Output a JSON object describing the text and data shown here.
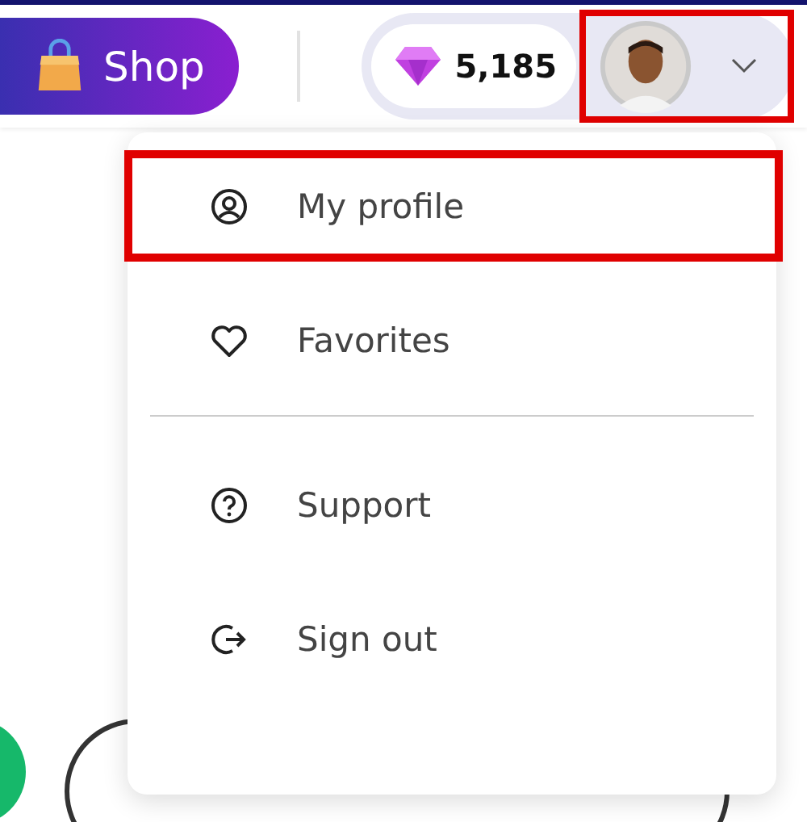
{
  "header": {
    "shop_button": {
      "label": "Shop"
    },
    "gems": {
      "count": "5,185"
    },
    "account_button": {
      "highlighted": true
    }
  },
  "menu": {
    "items": [
      {
        "kind": "profile",
        "label": "My profile",
        "highlighted": true
      },
      {
        "kind": "favorites",
        "label": "Favorites",
        "highlighted": false
      },
      {
        "kind": "divider"
      },
      {
        "kind": "support",
        "label": "Support",
        "highlighted": false
      },
      {
        "kind": "signout",
        "label": "Sign out",
        "highlighted": false
      }
    ]
  }
}
